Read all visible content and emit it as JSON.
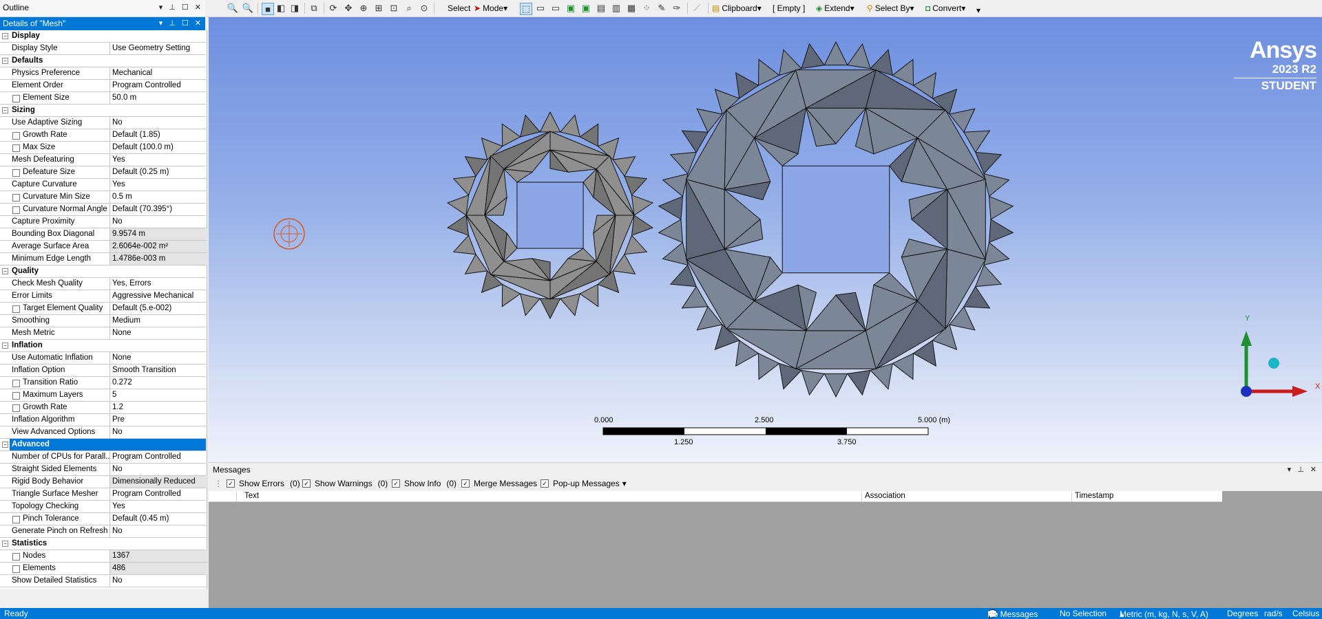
{
  "outline": {
    "title": "Outline"
  },
  "details": {
    "title": "Details of \"Mesh\"",
    "rows": [
      {
        "kind": "cat",
        "label": "Display"
      },
      {
        "label": "Display Style",
        "value": "Use Geometry Setting"
      },
      {
        "kind": "cat",
        "label": "Defaults"
      },
      {
        "label": "Physics Preference",
        "value": "Mechanical"
      },
      {
        "label": "Element Order",
        "value": "Program Controlled"
      },
      {
        "label": "Element Size",
        "value": "50.0 m",
        "check": true
      },
      {
        "kind": "cat",
        "label": "Sizing"
      },
      {
        "label": "Use Adaptive Sizing",
        "value": "No"
      },
      {
        "label": "Growth Rate",
        "value": "Default (1.85)",
        "check": true
      },
      {
        "label": "Max Size",
        "value": "Default (100.0 m)",
        "check": true
      },
      {
        "label": "Mesh Defeaturing",
        "value": "Yes"
      },
      {
        "label": "Defeature Size",
        "value": "Default (0.25 m)",
        "check": true
      },
      {
        "label": "Capture Curvature",
        "value": "Yes"
      },
      {
        "label": "Curvature Min Size",
        "value": "0.5 m",
        "check": true
      },
      {
        "label": "Curvature Normal Angle",
        "value": "Default (70.395°)",
        "check": true
      },
      {
        "label": "Capture Proximity",
        "value": "No"
      },
      {
        "label": "Bounding Box Diagonal",
        "value": "9.9574 m",
        "ro": true
      },
      {
        "label": "Average Surface Area",
        "value": "2.6064e-002 m²",
        "ro": true
      },
      {
        "label": "Minimum Edge Length",
        "value": "1.4786e-003 m",
        "ro": true
      },
      {
        "kind": "cat",
        "label": "Quality"
      },
      {
        "label": "Check Mesh Quality",
        "value": "Yes, Errors"
      },
      {
        "label": "Error Limits",
        "value": "Aggressive Mechanical"
      },
      {
        "label": "Target Element Quality",
        "value": "Default (5.e-002)",
        "check": true
      },
      {
        "label": "Smoothing",
        "value": "Medium"
      },
      {
        "label": "Mesh Metric",
        "value": "None"
      },
      {
        "kind": "cat",
        "label": "Inflation"
      },
      {
        "label": "Use Automatic Inflation",
        "value": "None"
      },
      {
        "label": "Inflation Option",
        "value": "Smooth Transition"
      },
      {
        "label": "Transition Ratio",
        "value": "0.272",
        "check": true
      },
      {
        "label": "Maximum Layers",
        "value": "5",
        "check": true
      },
      {
        "label": "Growth Rate",
        "value": "1.2",
        "check": true
      },
      {
        "label": "Inflation Algorithm",
        "value": "Pre"
      },
      {
        "label": "View Advanced Options",
        "value": "No"
      },
      {
        "kind": "cat",
        "label": "Advanced",
        "selected": true
      },
      {
        "label": "Number of CPUs for Parall...",
        "value": "Program Controlled"
      },
      {
        "label": "Straight Sided Elements",
        "value": "No"
      },
      {
        "label": "Rigid Body Behavior",
        "value": "Dimensionally Reduced",
        "ro": true
      },
      {
        "label": "Triangle Surface Mesher",
        "value": "Program Controlled"
      },
      {
        "label": "Topology Checking",
        "value": "Yes"
      },
      {
        "label": "Pinch Tolerance",
        "value": "Default (0.45 m)",
        "check": true
      },
      {
        "label": "Generate Pinch on Refresh",
        "value": "No"
      },
      {
        "kind": "cat",
        "label": "Statistics"
      },
      {
        "label": "Nodes",
        "value": "1367",
        "check": true,
        "ro": true
      },
      {
        "label": "Elements",
        "value": "486",
        "check": true,
        "ro": true
      },
      {
        "label": "Show Detailed Statistics",
        "value": "No"
      }
    ]
  },
  "toolbar": {
    "select": "Select",
    "mode": "Mode",
    "clipboard": "Clipboard",
    "empty": "[ Empty ]",
    "extend": "Extend",
    "select_by": "Select By",
    "convert": "Convert"
  },
  "logo": {
    "brand": "Ansys",
    "version": "2023 R2",
    "edition": "STUDENT"
  },
  "scale": {
    "labels_top": [
      "0.000",
      "2.500",
      "5.000 (m)"
    ],
    "labels_bottom": [
      "1.250",
      "3.750"
    ]
  },
  "triad": {
    "x": "X",
    "y": "Y"
  },
  "messages": {
    "title": "Messages",
    "filters": [
      {
        "label": "Show Errors",
        "count": "(0)"
      },
      {
        "label": "Show Warnings",
        "count": "(0)"
      },
      {
        "label": "Show Info",
        "count": "(0)"
      },
      {
        "label": "Merge Messages"
      },
      {
        "label": "Pop-up Messages"
      }
    ],
    "columns": [
      "Text",
      "Association",
      "Timestamp"
    ]
  },
  "status": {
    "ready": "Ready",
    "messages": "No Messages",
    "selection": "No Selection",
    "units": "Metric (m, kg, N, s, V, A)",
    "angle": "Degrees",
    "rate": "rad/s",
    "temp": "Celsius"
  },
  "colors": {
    "accent": "#0078d7",
    "mesh_large": "#7b8697",
    "mesh_small": "#8f8f8f"
  }
}
